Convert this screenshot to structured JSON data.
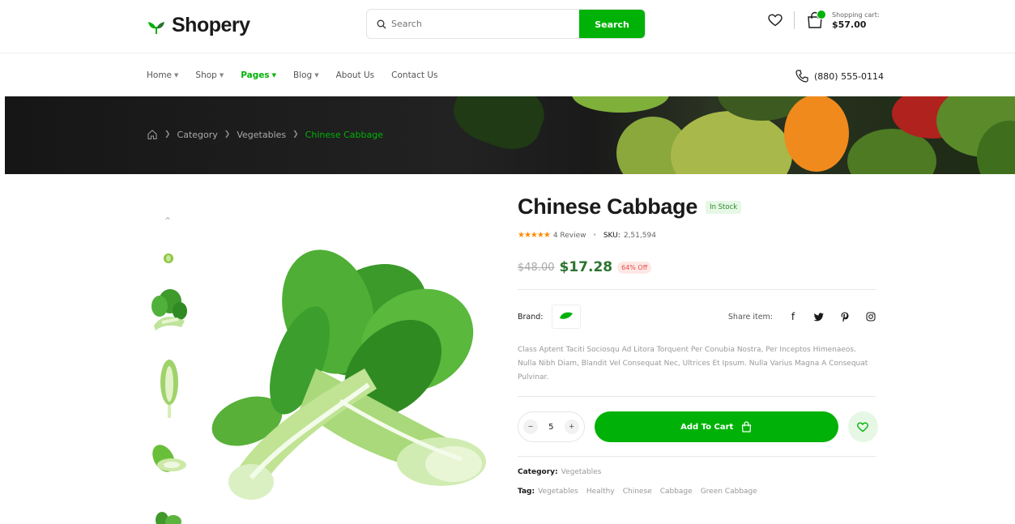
{
  "header": {
    "logo_text": "Shopery",
    "search_placeholder": "Search",
    "search_button": "Search",
    "cart_label": "Shopping cart:",
    "cart_total": "$57.00"
  },
  "nav": {
    "items": [
      {
        "label": "Home",
        "dropdown": true,
        "active": false
      },
      {
        "label": "Shop",
        "dropdown": true,
        "active": false
      },
      {
        "label": "Pages",
        "dropdown": true,
        "active": true
      },
      {
        "label": "Blog",
        "dropdown": true,
        "active": false
      },
      {
        "label": "About Us",
        "dropdown": false,
        "active": false
      },
      {
        "label": "Contact Us",
        "dropdown": false,
        "active": false
      }
    ],
    "phone": "(880) 555-0114"
  },
  "breadcrumb": {
    "items": [
      "Category",
      "Vegetables",
      "Chinese Cabbage"
    ]
  },
  "product": {
    "title": "Chinese Cabbage",
    "stock": "In Stock",
    "rating_stars": 4,
    "reviews": "4 Review",
    "sku_label": "SKU:",
    "sku": "2,51,594",
    "old_price": "$48.00",
    "new_price": "$17.28",
    "discount": "64% Off",
    "brand_label": "Brand:",
    "share_label": "Share item:",
    "description": "Class Aptent Taciti Sociosqu Ad Litora Torquent Per Conubia Nostra, Per Inceptos Himenaeos. Nulla Nibh Diam, Blandit Vel Consequat Nec, Ultrices Et Ipsum. Nulla Varius Magna A Consequat Pulvinar.",
    "quantity": "5",
    "add_to_cart": "Add To Cart",
    "category_label": "Category:",
    "category": "Vegetables",
    "tag_label": "Tag:",
    "tags": [
      "Vegetables",
      "Healthy",
      "Chinese",
      "Cabbage",
      "Green Cabbage"
    ]
  },
  "colors": {
    "accent": "#00b207",
    "price": "#2c742f",
    "discount": "#ea4b48",
    "star": "#ff8a00"
  }
}
